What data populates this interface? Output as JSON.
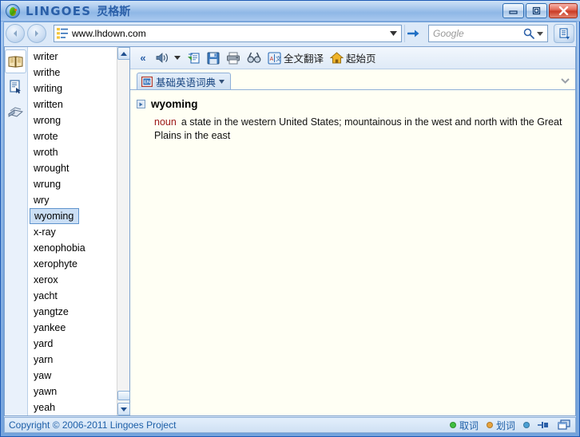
{
  "window": {
    "title_main": "LINGOES",
    "title_sub": "灵格斯",
    "app_icon": "lingoes-parrot-icon",
    "controls": {
      "minimize": "minimize-button",
      "maximize": "maximize-button",
      "close": "close-button"
    }
  },
  "addressbar": {
    "back": "back-icon",
    "forward": "forward-icon",
    "list_icon": "address-list-icon",
    "url": "www.lhdown.com",
    "dropdown": "chevron-down-icon",
    "go": "go-arrow-icon",
    "search_placeholder": "Google",
    "search_value": "",
    "search_icon": "magnifier-icon",
    "search_dropdown": "chevron-down-icon",
    "tools_button": "page-tools-icon"
  },
  "sidebar": {
    "icons": [
      {
        "name": "dictionary-book-icon",
        "selected": true
      },
      {
        "name": "document-search-icon",
        "selected": false
      },
      {
        "name": "notebook-stack-icon",
        "selected": false
      }
    ]
  },
  "wordlist": {
    "selected": "wyoming",
    "items": [
      "writer",
      "writhe",
      "writing",
      "written",
      "wrong",
      "wrote",
      "wroth",
      "wrought",
      "wrung",
      "wry",
      "wyoming",
      "x-ray",
      "xenophobia",
      "xerophyte",
      "xerox",
      "yacht",
      "yangtze",
      "yankee",
      "yard",
      "yarn",
      "yaw",
      "yawn",
      "yeah"
    ],
    "scrollbar": {
      "up": "scroll-up-icon",
      "down": "scroll-down-icon"
    }
  },
  "dict_toolbar": {
    "collapse_label": "«",
    "items": [
      {
        "icon": "speaker-icon",
        "label": "",
        "has_dropdown": true
      },
      {
        "icon": "copy-icon",
        "label": ""
      },
      {
        "icon": "save-icon",
        "label": ""
      },
      {
        "icon": "print-icon",
        "label": ""
      },
      {
        "icon": "find-icon",
        "label": ""
      },
      {
        "icon": "translate-icon",
        "label": "全文翻译"
      },
      {
        "icon": "home-icon",
        "label": "起始页"
      }
    ]
  },
  "dictionary": {
    "tab_label": "基础英语词典",
    "tab_icon": "en-dictionary-icon",
    "tab_dropdown": "chevron-down-icon",
    "panel_chevron": "chevron-down-icon",
    "entry": {
      "word": "wyoming",
      "pos": "noun",
      "definition": "a state in the western United States; mountainous in the west and north with the Great Plains in the east"
    }
  },
  "statusbar": {
    "copyright": "Copyright © 2006-2011 Lingoes Project",
    "items": [
      {
        "label": "取词",
        "dot_color": "#3fbf3f"
      },
      {
        "label": "划词",
        "dot_color": "#e8a33d"
      },
      {
        "label": "",
        "dot_color": "#4a9fd4"
      }
    ],
    "icons": [
      {
        "name": "pin-icon"
      },
      {
        "name": "restore-window-icon"
      }
    ]
  },
  "colors": {
    "accent": "#2a5fa8",
    "titlebar": "#a9c8ee",
    "content_bg": "#fffff4",
    "pos_color": "#9b1616",
    "selection": "#cbdff5"
  }
}
